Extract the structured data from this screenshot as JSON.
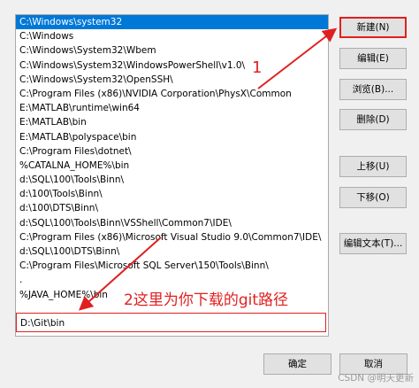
{
  "path_list": [
    "C:\\Windows\\system32",
    "C:\\Windows",
    "C:\\Windows\\System32\\Wbem",
    "C:\\Windows\\System32\\WindowsPowerShell\\v1.0\\",
    "C:\\Windows\\System32\\OpenSSH\\",
    "C:\\Program Files (x86)\\NVIDIA Corporation\\PhysX\\Common",
    "E:\\MATLAB\\runtime\\win64",
    "E:\\MATLAB\\bin",
    "E:\\MATLAB\\polyspace\\bin",
    "C:\\Program Files\\dotnet\\",
    "%CATALNA_HOME%\\bin",
    "d:\\SQL\\100\\Tools\\Binn\\",
    "d:\\100\\Tools\\Binn\\",
    "d:\\100\\DTS\\Binn\\",
    "d:\\SQL\\100\\Tools\\Binn\\VSShell\\Common7\\IDE\\",
    "C:\\Program Files (x86)\\Microsoft Visual Studio 9.0\\Common7\\IDE\\",
    "d:\\SQL\\100\\DTS\\Binn\\",
    "C:\\Program Files\\Microsoft SQL Server\\150\\Tools\\Binn\\",
    ".",
    "%JAVA_HOME%\\bin"
  ],
  "editing_entry": "D:\\Git\\bin",
  "buttons": {
    "new": "新建(N)",
    "edit": "编辑(E)",
    "browse": "浏览(B)...",
    "delete": "删除(D)",
    "move_up": "上移(U)",
    "move_down": "下移(O)",
    "edit_text": "编辑文本(T)...",
    "ok": "确定",
    "cancel": "取消"
  },
  "annotations": {
    "step1": "1",
    "step2": "2这里为你下载的git路径"
  },
  "watermark": "CSDN @明天更新",
  "colors": {
    "selection": "#0078d7",
    "annotation": "#e02020"
  }
}
